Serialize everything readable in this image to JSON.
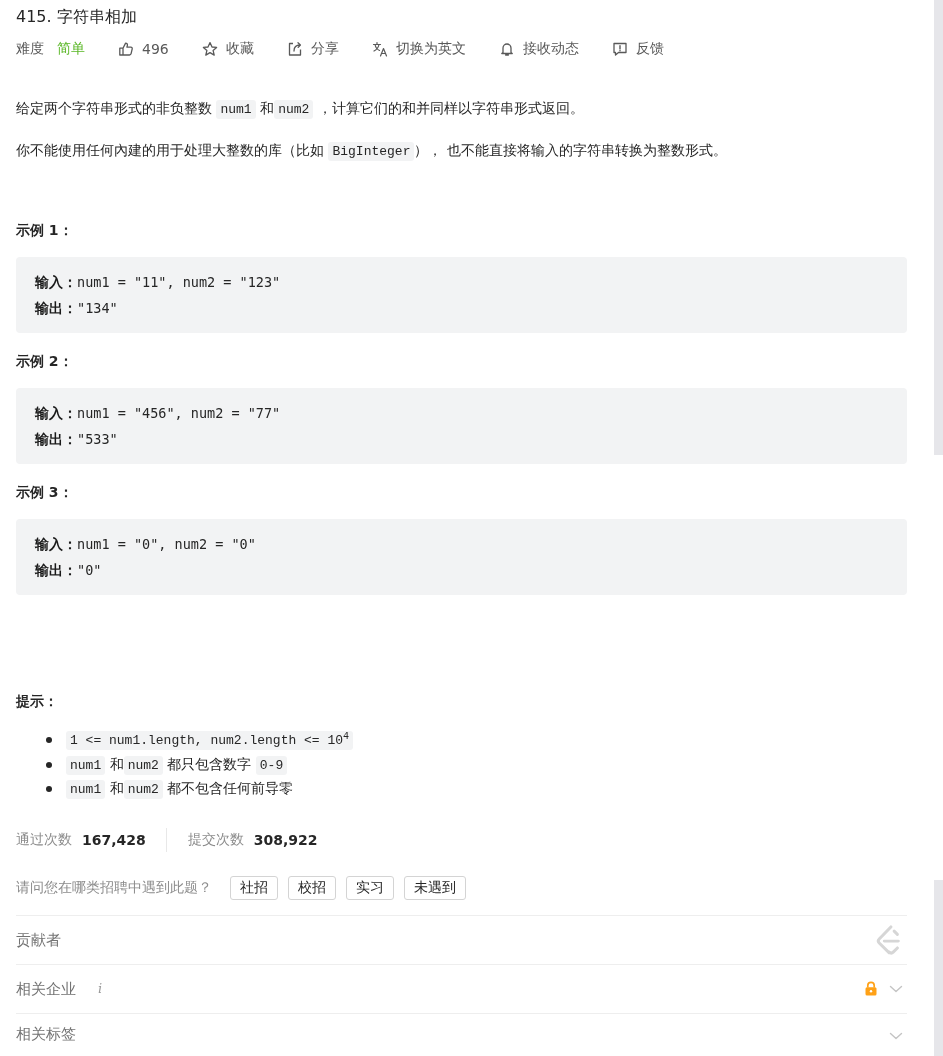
{
  "problem": {
    "title": "415. 字符串相加"
  },
  "meta": {
    "difficulty": {
      "label": "难度",
      "value": "简单",
      "kind": "easy"
    },
    "actions": [
      {
        "kind": "like",
        "label": "496"
      },
      {
        "kind": "star",
        "label": "收藏"
      },
      {
        "kind": "share",
        "label": "分享"
      },
      {
        "kind": "translate",
        "label": "切换为英文"
      },
      {
        "kind": "bell",
        "label": "接收动态"
      },
      {
        "kind": "feedback",
        "label": "反馈"
      }
    ]
  },
  "description": [
    [
      {
        "kind": "text",
        "text": "给定两个字符串形式的非负整数 "
      },
      {
        "kind": "code",
        "text": "num1"
      },
      {
        "kind": "text",
        "text": " 和"
      },
      {
        "kind": "code",
        "text": "num2"
      },
      {
        "kind": "text",
        "text": " ，计算它们的和并同样以字符串形式返回。"
      }
    ],
    [
      {
        "kind": "text",
        "text": "你不能使用任何內建的用于处理大整数的库（比如 "
      },
      {
        "kind": "code",
        "text": "BigInteger"
      },
      {
        "kind": "text",
        "text": "）， 也不能直接将输入的字符串转换为整数形式。"
      }
    ]
  ],
  "examples": [
    {
      "title": "示例 1：",
      "lines": [
        "**输入：**num1 = \"11\", num2 = \"123\"",
        "**输出：**\"134\""
      ]
    },
    {
      "title": "示例 2：",
      "lines": [
        "**输入：**num1 = \"456\", num2 = \"77\"",
        "**输出：**\"533\""
      ]
    },
    {
      "title": "示例 3：",
      "lines": [
        "**输入：**num1 = \"0\", num2 = \"0\"",
        "**输出：**\"0\""
      ]
    }
  ],
  "hints": {
    "title": "提示：",
    "items": [
      [
        {
          "kind": "code",
          "text": "1 <= num1.length, num2.length <= 10$^{4}$"
        }
      ],
      [
        {
          "kind": "code",
          "text": "num1"
        },
        {
          "kind": "text",
          "text": " 和"
        },
        {
          "kind": "code",
          "text": "num2"
        },
        {
          "kind": "text",
          "text": " 都只包含数字 "
        },
        {
          "kind": "code",
          "text": "0-9"
        }
      ],
      [
        {
          "kind": "code",
          "text": "num1"
        },
        {
          "kind": "text",
          "text": " 和"
        },
        {
          "kind": "code",
          "text": "num2"
        },
        {
          "kind": "text",
          "text": " 都不包含任何前导零"
        }
      ]
    ]
  },
  "stats": [
    {
      "label": "通过次数",
      "value": "167,428"
    },
    {
      "label": "提交次数",
      "value": "308,922"
    }
  ],
  "recruit": {
    "question": "请问您在哪类招聘中遇到此题？",
    "options": [
      {
        "label": "社招",
        "selected": false
      },
      {
        "label": "校招",
        "selected": false
      },
      {
        "label": "实习",
        "selected": false
      },
      {
        "label": "未遇到",
        "selected": false
      }
    ]
  },
  "sections": [
    {
      "kind": "contributors",
      "label": "贡献者"
    },
    {
      "kind": "companies",
      "label": "相关企业",
      "info": "i",
      "locked": true,
      "expanded": false
    },
    {
      "kind": "tags",
      "label": "相关标签",
      "expanded": false
    }
  ]
}
